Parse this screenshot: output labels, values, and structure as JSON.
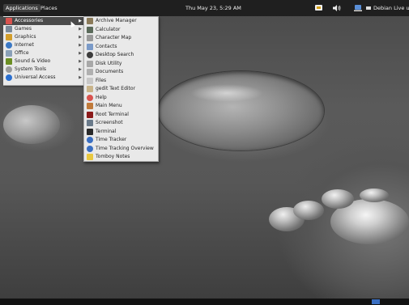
{
  "topbar": {
    "applications_label": "Applications",
    "places_label": "Places",
    "clock": "Thu May 23,  5:29 AM",
    "user_label": "Debian Live use",
    "tray_icons": [
      "network-icon",
      "volume-icon",
      "accessibility-icon"
    ]
  },
  "menu": {
    "categories": [
      {
        "label": "Accessories",
        "icon": "accessories-icon",
        "color": "#d9534f"
      },
      {
        "label": "Games",
        "icon": "games-icon",
        "color": "#7a8a9a"
      },
      {
        "label": "Graphics",
        "icon": "graphics-icon",
        "color": "#d39e2b"
      },
      {
        "label": "Internet",
        "icon": "internet-icon",
        "color": "#3b78c4"
      },
      {
        "label": "Office",
        "icon": "office-icon",
        "color": "#8aa0b8"
      },
      {
        "label": "Sound & Video",
        "icon": "sound-video-icon",
        "color": "#6b8e23"
      },
      {
        "label": "System Tools",
        "icon": "system-tools-icon",
        "color": "#9a9a9a"
      },
      {
        "label": "Universal Access",
        "icon": "universal-access-icon",
        "color": "#2a6fd0"
      }
    ],
    "applications": [
      {
        "label": "Archive Manager",
        "icon": "archive-manager-icon",
        "color": "#8b7b5a"
      },
      {
        "label": "Calculator",
        "icon": "calculator-icon",
        "color": "#5a6a5a"
      },
      {
        "label": "Character Map",
        "icon": "character-map-icon",
        "color": "#9a9a9a"
      },
      {
        "label": "Contacts",
        "icon": "contacts-icon",
        "color": "#7a9ac8"
      },
      {
        "label": "Desktop Search",
        "icon": "desktop-search-icon",
        "color": "#3c3c3c"
      },
      {
        "label": "Disk Utility",
        "icon": "disk-utility-icon",
        "color": "#a8a8a8"
      },
      {
        "label": "Documents",
        "icon": "documents-icon",
        "color": "#b0b0b0"
      },
      {
        "label": "Files",
        "icon": "files-icon",
        "color": "#c8c8c8"
      },
      {
        "label": "gedit Text Editor",
        "icon": "gedit-icon",
        "color": "#c9b48a"
      },
      {
        "label": "Help",
        "icon": "help-icon",
        "color": "#d9534f"
      },
      {
        "label": "Main Menu",
        "icon": "main-menu-icon",
        "color": "#c07a3a"
      },
      {
        "label": "Root Terminal",
        "icon": "root-terminal-icon",
        "color": "#8b1a1a"
      },
      {
        "label": "Screenshot",
        "icon": "screenshot-icon",
        "color": "#6a7a8a"
      },
      {
        "label": "Terminal",
        "icon": "terminal-icon",
        "color": "#2a2a2a"
      },
      {
        "label": "Time Tracker",
        "icon": "time-tracker-icon",
        "color": "#3a6fc2"
      },
      {
        "label": "Time Tracking Overview",
        "icon": "time-tracking-overview-icon",
        "color": "#3a6fc2"
      },
      {
        "label": "Tomboy Notes",
        "icon": "tomboy-notes-icon",
        "color": "#e8c840"
      }
    ]
  },
  "bottombar": {
    "workspace_color": "#3a6fc2"
  }
}
